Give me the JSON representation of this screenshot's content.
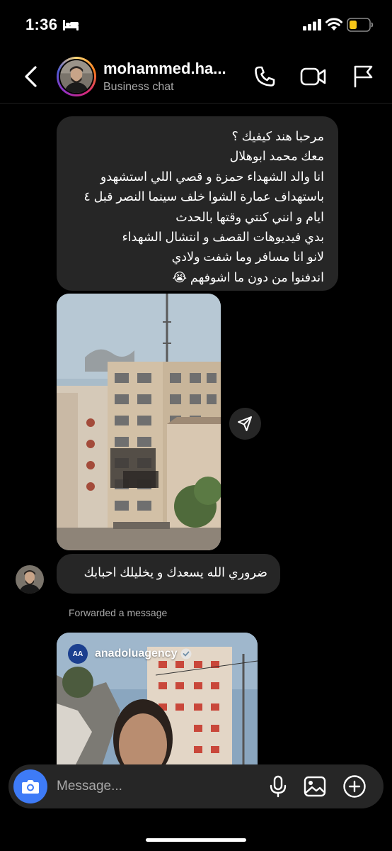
{
  "status_bar": {
    "time": "1:36",
    "icons": [
      "bed-icon",
      "signal-icon",
      "wifi-icon",
      "battery-icon"
    ]
  },
  "header": {
    "username": "mohammed.ha...",
    "subtitle": "Business chat",
    "icons": [
      "back-icon",
      "call-icon",
      "video-icon",
      "flag-icon"
    ]
  },
  "messages": [
    {
      "type": "text",
      "lines": [
        "مرحبا هند كيفيك ؟",
        "معك محمد ابوهلال",
        "انا والد الشهداء حمزة و قصي اللي استشهدو",
        "باستهداف عمارة الشوا خلف سينما النصر قبل ٤",
        "ايام و انني كنتي وقتها بالحدث",
        "بدي فيديوهات القصف و انتشال الشهداء",
        "لانو انا مسافر وما شفت ولادي",
        "اندفنوا من دون ما اشوفهم 😭"
      ]
    },
    {
      "type": "photo"
    },
    {
      "type": "text",
      "text": "ضروري الله يسعدك و يخليلك احبابك"
    }
  ],
  "forwarded_label": "Forwarded a message",
  "forwarded_reel": {
    "logo_text": "AA",
    "username": "anadoluagency",
    "verified": true
  },
  "composer": {
    "placeholder": "Message...",
    "icons": [
      "camera-icon",
      "mic-icon",
      "gallery-icon",
      "plus-icon"
    ]
  },
  "colors": {
    "background": "#000000",
    "bubble": "#262626",
    "accent_blue": "#3e7bf7",
    "secondary_text": "#a8a8a8",
    "battery": "#f5c518"
  }
}
